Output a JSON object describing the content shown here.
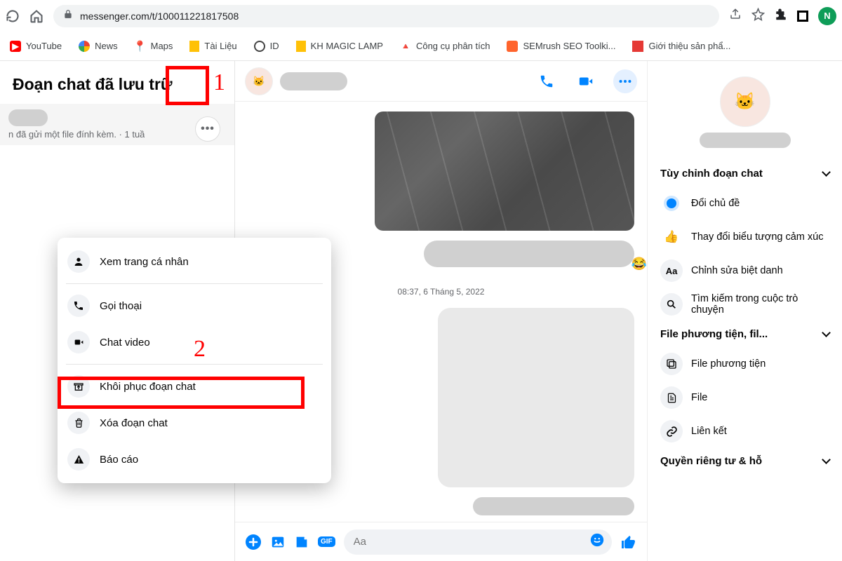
{
  "browser": {
    "url": "messenger.com/t/100011221817508",
    "profile_letter": "N"
  },
  "bookmarks": [
    {
      "label": "YouTube",
      "icon": "youtube"
    },
    {
      "label": "News",
      "icon": "google"
    },
    {
      "label": "Maps",
      "icon": "maps"
    },
    {
      "label": "Tài Liệu",
      "icon": "doc"
    },
    {
      "label": "ID",
      "icon": "globe"
    },
    {
      "label": "KH MAGIC LAMP",
      "icon": "doc"
    },
    {
      "label": "Công cụ phân tích",
      "icon": "drive"
    },
    {
      "label": "SEMrush SEO Toolki...",
      "icon": "semrush"
    },
    {
      "label": "Giới thiệu sản phẩ...",
      "icon": "redbox"
    }
  ],
  "sidebar": {
    "title": "Đoạn chat đã lưu trữ",
    "chat_subtitle": "n đã gửi một file đính kèm. · 1 tuầ"
  },
  "context_menu": {
    "items": [
      {
        "icon": "person",
        "label": "Xem trang cá nhân"
      },
      {
        "divider": true
      },
      {
        "icon": "phone",
        "label": "Gọi thoại"
      },
      {
        "icon": "video",
        "label": "Chat video"
      },
      {
        "divider": true
      },
      {
        "icon": "unarchive",
        "label": "Khôi phục đoạn chat"
      },
      {
        "icon": "trash",
        "label": "Xóa đoạn chat"
      },
      {
        "icon": "warn",
        "label": "Báo cáo"
      }
    ]
  },
  "chat": {
    "timestamp": "08:37, 6 Tháng 5, 2022",
    "compose_placeholder": "Aa"
  },
  "rightbar": {
    "sections": {
      "customize": "Tùy chỉnh đoạn chat",
      "media": "File phương tiện, fil...",
      "privacy": "Quyền riêng tư & hỗ"
    },
    "rows": {
      "theme": "Đổi chủ đề",
      "emoji": "Thay đổi biểu tượng cảm xúc",
      "nickname": "Chỉnh sửa biệt danh",
      "search": "Tìm kiếm trong cuộc trò chuyện",
      "media_files": "File phương tiện",
      "files": "File",
      "links": "Liên kết"
    }
  },
  "annotations": {
    "one": "1",
    "two": "2"
  }
}
